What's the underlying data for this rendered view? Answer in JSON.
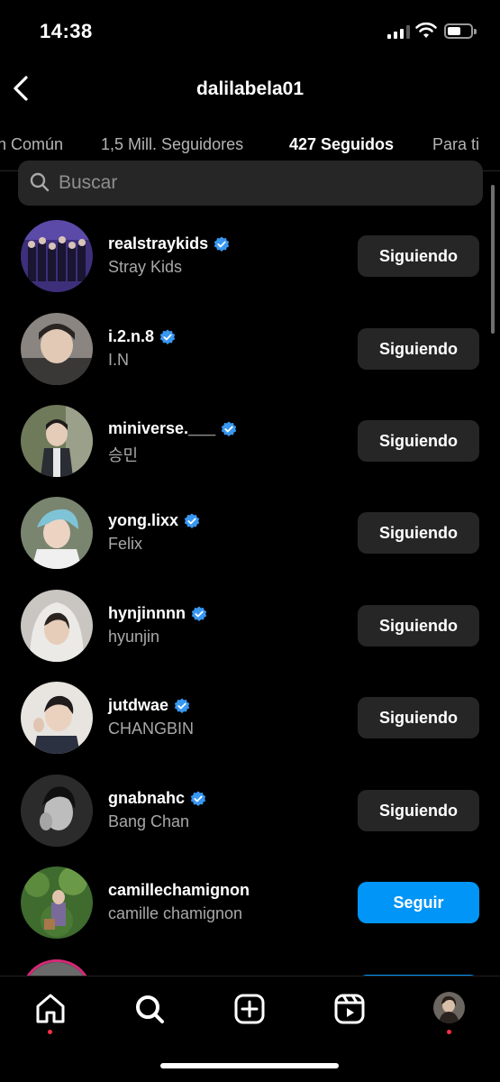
{
  "status_bar": {
    "time": "14:38"
  },
  "header": {
    "title": "dalilabela01"
  },
  "tabs": [
    {
      "label": "n Común"
    },
    {
      "label": "1,5 Mill. Seguidores"
    },
    {
      "label": "427 Seguidos"
    },
    {
      "label": "Para ti"
    }
  ],
  "search": {
    "placeholder": "Buscar"
  },
  "users": [
    {
      "username": "realstraykids",
      "name": "Stray Kids",
      "verified": true,
      "button": "Siguiendo"
    },
    {
      "username": "i.2.n.8",
      "name": "I.N",
      "verified": true,
      "button": "Siguiendo"
    },
    {
      "username": "miniverse.___",
      "name": "승민",
      "verified": true,
      "button": "Siguiendo"
    },
    {
      "username": "yong.lixx",
      "name": "Felix",
      "verified": true,
      "button": "Siguiendo"
    },
    {
      "username": "hynjinnnn",
      "name": "hyunjin",
      "verified": true,
      "button": "Siguiendo"
    },
    {
      "username": "jutdwae",
      "name": "CHANGBIN",
      "verified": true,
      "button": "Siguiendo"
    },
    {
      "username": "gnabnahc",
      "name": "Bang Chan",
      "verified": true,
      "button": "Siguiendo"
    },
    {
      "username": "camillechamignon",
      "name": "camille chamignon",
      "verified": false,
      "button": "Seguir"
    }
  ],
  "nav": {
    "icons": [
      "home-icon",
      "search-icon",
      "create-icon",
      "reels-icon",
      "profile-avatar"
    ]
  },
  "colors": {
    "background": "#000000",
    "button_gray": "#262626",
    "button_blue": "#0095f6",
    "verified": "#3897f0",
    "notification_dot": "#ff3040"
  }
}
